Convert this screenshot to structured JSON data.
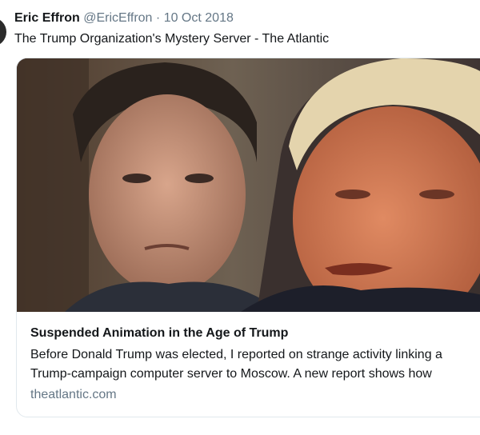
{
  "tweet": {
    "author_name": "Eric Effron",
    "author_handle": "@EricEffron",
    "separator": "·",
    "date": "10 Oct 2018",
    "text": "The Trump Organization's Mystery Server - The Atlantic"
  },
  "card": {
    "title": "Suspended Animation in the Age of Trump",
    "description_line1": "Before Donald Trump was elected, I reported on strange activity linking a",
    "description_line2": "Trump-campaign computer server to Moscow. A new report shows how",
    "domain": "theatlantic.com"
  }
}
